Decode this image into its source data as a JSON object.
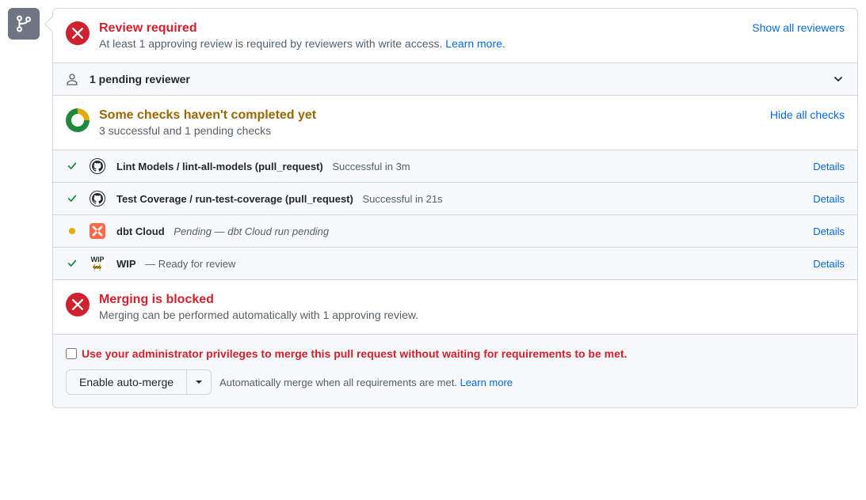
{
  "review": {
    "title": "Review required",
    "subtext": "At least 1 approving review is required by reviewers with write access.",
    "learn_more": "Learn more.",
    "show_all": "Show all reviewers"
  },
  "pending": {
    "label": "1 pending reviewer"
  },
  "checks": {
    "title": "Some checks haven't completed yet",
    "subtext": "3 successful and 1 pending checks",
    "hide_all": "Hide all checks",
    "items": [
      {
        "status": "success",
        "avatar": "gh",
        "name": "Lint Models / lint-all-models (pull_request)",
        "desc": "Successful in 3m",
        "italic": false,
        "details": "Details"
      },
      {
        "status": "success",
        "avatar": "gh",
        "name": "Test Coverage / run-test-coverage (pull_request)",
        "desc": "Successful in 21s",
        "italic": false,
        "details": "Details"
      },
      {
        "status": "pending",
        "avatar": "dbt",
        "name": "dbt Cloud",
        "desc": "Pending — dbt Cloud run pending",
        "italic": true,
        "details": "Details"
      },
      {
        "status": "success",
        "avatar": "wip",
        "name": "WIP",
        "desc": "— Ready for review",
        "italic": false,
        "details": "Details"
      }
    ]
  },
  "blocked": {
    "title": "Merging is blocked",
    "subtext": "Merging can be performed automatically with 1 approving review."
  },
  "admin": {
    "text": "Use your administrator privileges to merge this pull request without waiting for requirements to be met."
  },
  "automerge": {
    "button": "Enable auto-merge",
    "text": "Automatically merge when all requirements are met.",
    "learn_more": "Learn more"
  }
}
